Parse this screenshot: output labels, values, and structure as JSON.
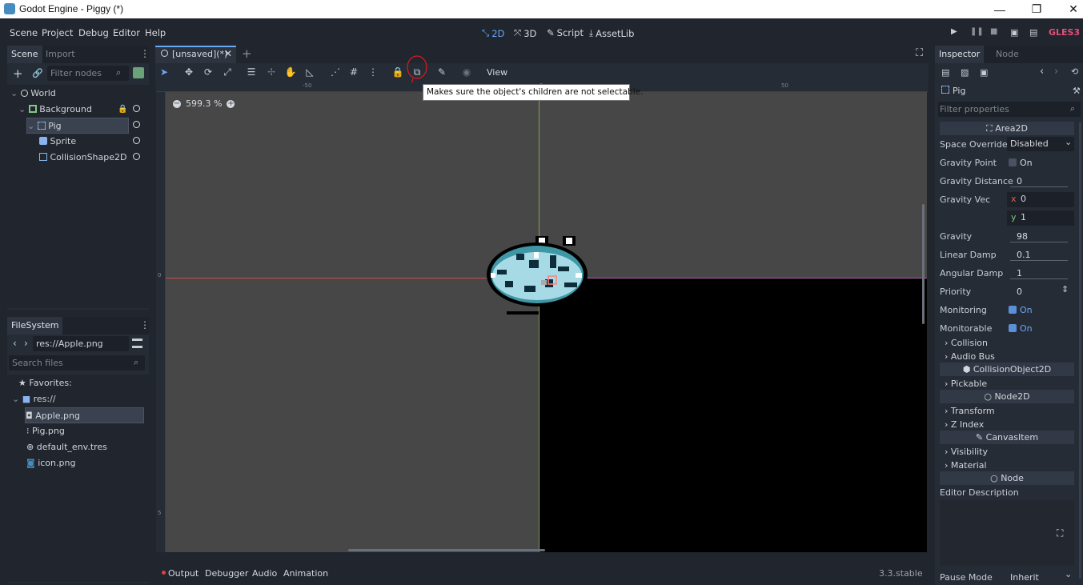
{
  "window": {
    "title": "Godot Engine - Piggy (*)",
    "minimize": "—",
    "maximize": "❐",
    "close": "✕"
  },
  "menu": [
    "Scene",
    "Project",
    "Debug",
    "Editor",
    "Help"
  ],
  "workspaces": [
    {
      "label": "2D",
      "icon": "2d-icon"
    },
    {
      "label": "3D",
      "icon": "3d-icon"
    },
    {
      "label": "Script",
      "icon": "script-icon"
    },
    {
      "label": "AssetLib",
      "icon": "assetlib-icon"
    }
  ],
  "renderer": "GLES3",
  "scene_dock": {
    "tabs": [
      "Scene",
      "Import"
    ],
    "filter_placeholder": "Filter nodes",
    "nodes": [
      {
        "label": "World",
        "icon": "node2d-icon"
      },
      {
        "label": "Background",
        "icon": "sprite-icon"
      },
      {
        "label": "Pig",
        "icon": "area2d-icon"
      },
      {
        "label": "Sprite",
        "icon": "sprite-icon"
      },
      {
        "label": "CollisionShape2D",
        "icon": "collisionshape-icon"
      }
    ]
  },
  "filesystem": {
    "tab": "FileSystem",
    "path": "res://Apple.png",
    "search_placeholder": "Search files",
    "favorites": "Favorites:",
    "root": "res://",
    "files": [
      "Apple.png",
      "Pig.png",
      "default_env.tres",
      "icon.png"
    ]
  },
  "editor": {
    "scene_tab": "[unsaved](*)",
    "view_menu": "View",
    "zoom": "599.3 %",
    "tooltip": "Makes sure the object's children are not selectable.",
    "ruler_ticks": [
      "-50",
      "0",
      "50"
    ],
    "ruler_v_ticks": [
      "0",
      "5"
    ]
  },
  "bottom_panel": {
    "tabs": [
      "Output",
      "Debugger",
      "Audio",
      "Animation"
    ],
    "version": "3.3.stable"
  },
  "inspector": {
    "tabs": [
      "Inspector",
      "Node"
    ],
    "node_name": "Pig",
    "filter_placeholder": "Filter properties",
    "class_header": "Area2D",
    "props": {
      "space_override": {
        "label": "Space Override",
        "value": "Disabled"
      },
      "gravity_point": {
        "label": "Gravity Point",
        "value": "On"
      },
      "gravity_distance": {
        "label": "Gravity Distance",
        "value": "0"
      },
      "gravity_vec": {
        "label": "Gravity Vec",
        "x": "0",
        "y": "1",
        "x_label": "x",
        "y_label": "y"
      },
      "gravity": {
        "label": "Gravity",
        "value": "98"
      },
      "linear_damp": {
        "label": "Linear Damp",
        "value": "0.1"
      },
      "angular_damp": {
        "label": "Angular Damp",
        "value": "1"
      },
      "priority": {
        "label": "Priority",
        "value": "0"
      },
      "monitoring": {
        "label": "Monitoring",
        "value": "On"
      },
      "monitorable": {
        "label": "Monitorable",
        "value": "On"
      }
    },
    "groups1": [
      "Collision",
      "Audio Bus"
    ],
    "collision_object": "CollisionObject2D",
    "groups2": [
      "Pickable"
    ],
    "node2d": "Node2D",
    "groups3": [
      "Transform",
      "Z Index"
    ],
    "canvas_item": "CanvasItem",
    "groups4": [
      "Visibility",
      "Material"
    ],
    "node": "Node",
    "editor_description": "Editor Description",
    "pause_mode": {
      "label": "Pause Mode",
      "value": "Inherit"
    }
  },
  "colors": {
    "accent": "#6aa7f5",
    "bg": "#20252e",
    "panel": "#262c36",
    "renderer": "#e0507a",
    "annotation": "#e0191f"
  }
}
